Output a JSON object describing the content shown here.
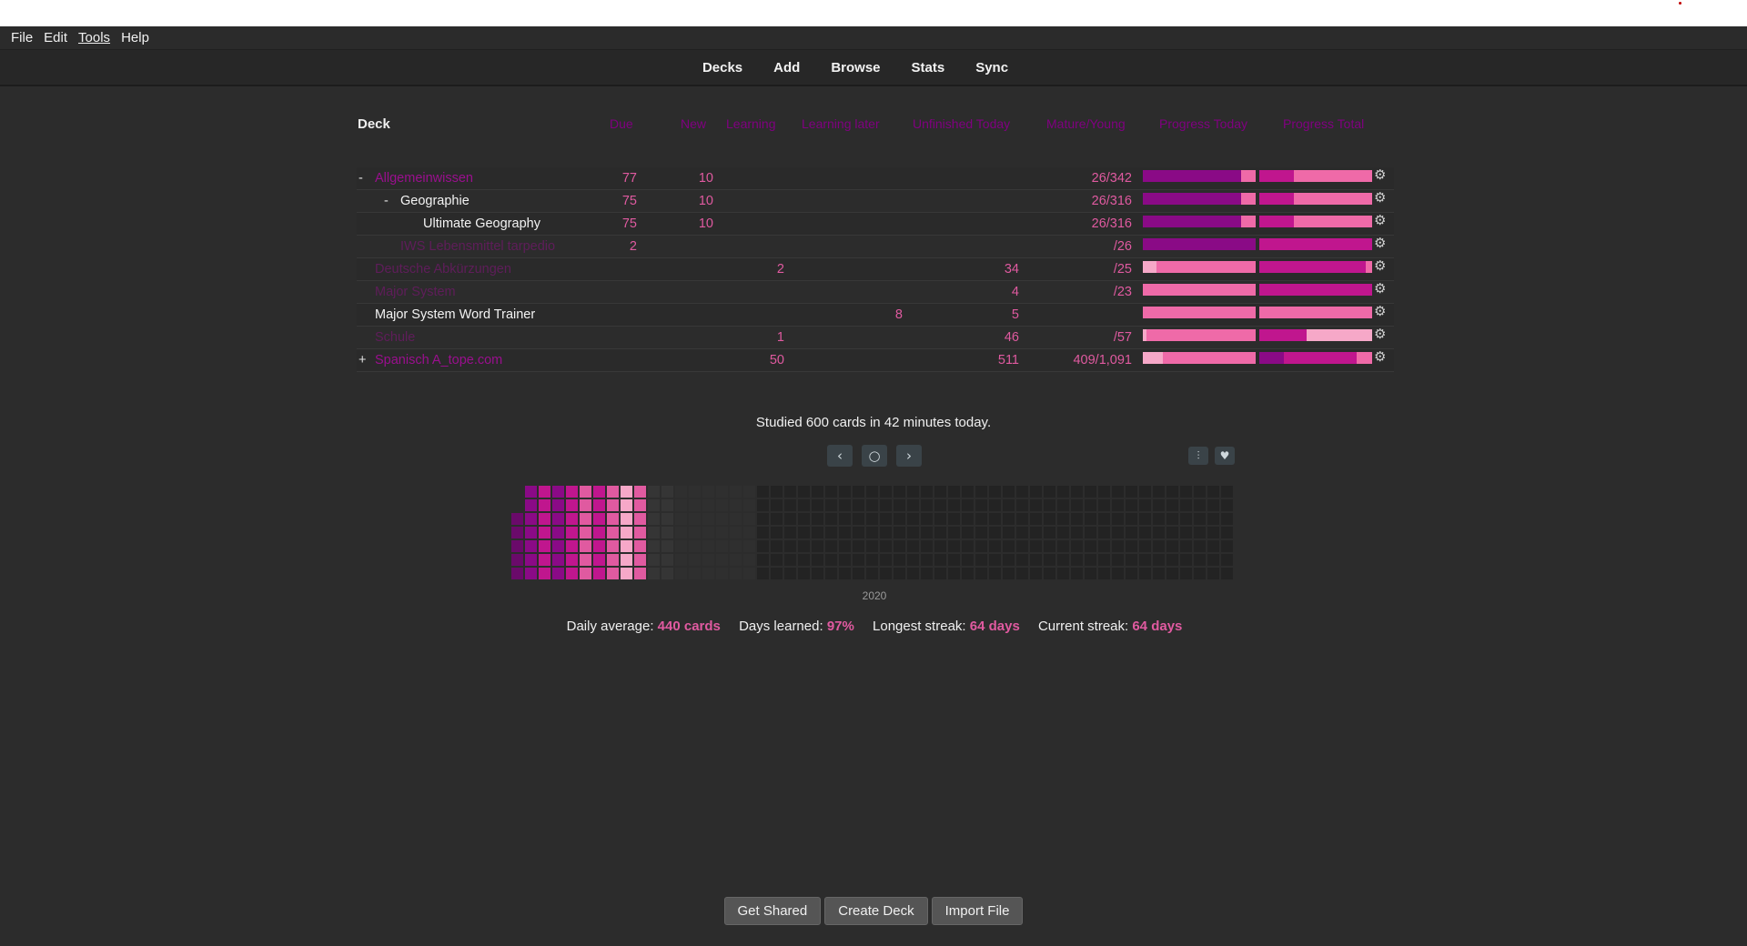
{
  "menu": {
    "file": "File",
    "edit": "Edit",
    "tools": "Tools",
    "help": "Help"
  },
  "toolbar": {
    "decks": "Decks",
    "add": "Add",
    "browse": "Browse",
    "stats": "Stats",
    "sync": "Sync"
  },
  "deck_table": {
    "header": {
      "deck": "Deck",
      "due": "Due",
      "new": "New",
      "learning": "Learning",
      "learning_later": "Learning later",
      "unfinished_today": "Unfinished Today",
      "mature_young": "Mature/Young",
      "progress_today": "Progress Today",
      "progress_total": "Progress Total"
    },
    "rows": [
      {
        "collapse": "-",
        "name": "Allgemeinwissen",
        "due": "77",
        "new": "10",
        "learning": "",
        "learning_later": "",
        "unfinished": "",
        "mature": "26/342"
      },
      {
        "collapse": "-",
        "name": "Geographie",
        "due": "75",
        "new": "10",
        "learning": "",
        "learning_later": "",
        "unfinished": "",
        "mature": "26/316"
      },
      {
        "collapse": "",
        "name": "Ultimate Geography",
        "due": "75",
        "new": "10",
        "learning": "",
        "learning_later": "",
        "unfinished": "",
        "mature": "26/316"
      },
      {
        "collapse": "",
        "name": "IWS Lebensmittel tarpedio",
        "due": "2",
        "new": "",
        "learning": "",
        "learning_later": "",
        "unfinished": "",
        "mature": "/26"
      },
      {
        "collapse": "",
        "name": "Deutsche Abkürzungen",
        "due": "",
        "new": "",
        "learning": "2",
        "learning_later": "",
        "unfinished": "34",
        "mature": "/25"
      },
      {
        "collapse": "",
        "name": "Major System",
        "due": "",
        "new": "",
        "learning": "",
        "learning_later": "",
        "unfinished": "4",
        "mature": "/23"
      },
      {
        "collapse": "",
        "name": "Major System Word Trainer",
        "due": "",
        "new": "",
        "learning": "",
        "learning_later": "8",
        "unfinished": "5",
        "mature": ""
      },
      {
        "collapse": "",
        "name": "Schule",
        "due": "",
        "new": "",
        "learning": "1",
        "learning_later": "",
        "unfinished": "46",
        "mature": "/57"
      },
      {
        "collapse": "+",
        "name": "Spanisch A_tope.com",
        "due": "",
        "new": "",
        "learning": "50",
        "learning_later": "",
        "unfinished": "511",
        "mature": "409/1,091"
      }
    ]
  },
  "progress": {
    "colors": {
      "dark": "#8a0a86",
      "mid": "#c0168e",
      "pink": "#ef6aa8",
      "light": "#f6a8c8",
      "accent": "#e05aa0"
    },
    "today": [
      [
        {
          "c": "dark",
          "f": 0.87
        },
        {
          "c": "pink",
          "f": 0.13
        }
      ],
      [
        {
          "c": "dark",
          "f": 0.87
        },
        {
          "c": "pink",
          "f": 0.13
        }
      ],
      [
        {
          "c": "dark",
          "f": 0.87
        },
        {
          "c": "pink",
          "f": 0.13
        }
      ],
      [
        {
          "c": "dark",
          "f": 1.0
        }
      ],
      [
        {
          "c": "light",
          "f": 0.12
        },
        {
          "c": "pink",
          "f": 0.88
        }
      ],
      [
        {
          "c": "pink",
          "f": 1.0
        }
      ],
      [
        {
          "c": "pink",
          "f": 1.0
        }
      ],
      [
        {
          "c": "light",
          "f": 0.03
        },
        {
          "c": "pink",
          "f": 0.97
        }
      ],
      [
        {
          "c": "light",
          "f": 0.18
        },
        {
          "c": "pink",
          "f": 0.82
        }
      ]
    ],
    "total": [
      [
        {
          "c": "mid",
          "f": 0.31
        },
        {
          "c": "pink",
          "f": 0.69
        }
      ],
      [
        {
          "c": "mid",
          "f": 0.31
        },
        {
          "c": "pink",
          "f": 0.69
        }
      ],
      [
        {
          "c": "mid",
          "f": 0.31
        },
        {
          "c": "pink",
          "f": 0.69
        }
      ],
      [
        {
          "c": "mid",
          "f": 1.0
        }
      ],
      [
        {
          "c": "mid",
          "f": 0.94
        },
        {
          "c": "pink",
          "f": 0.06
        }
      ],
      [
        {
          "c": "mid",
          "f": 1.0
        }
      ],
      [
        {
          "c": "pink",
          "f": 1.0
        }
      ],
      [
        {
          "c": "mid",
          "f": 0.42
        },
        {
          "c": "light",
          "f": 0.58
        }
      ],
      [
        {
          "c": "dark",
          "f": 0.22
        },
        {
          "c": "mid",
          "f": 0.64
        },
        {
          "c": "pink",
          "f": 0.14
        }
      ]
    ]
  },
  "stats": {
    "studied_text": "Studied 600 cards in 42 minutes today.",
    "year": "2020",
    "daily_average_label": "Daily average:",
    "daily_average_value": "440 cards",
    "days_learned_label": "Days learned:",
    "days_learned_value": "97%",
    "longest_streak_label": "Longest streak:",
    "longest_streak_value": "64 days",
    "current_streak_label": "Current streak:",
    "current_streak_value": "64 days"
  },
  "heatmap_nav": {
    "prev": "‹",
    "today": "○",
    "next": "›",
    "options_icon": "sliders-icon",
    "heart_icon": "heart-icon"
  },
  "buttons": {
    "get_shared": "Get Shared",
    "create_deck": "Create Deck",
    "import_file": "Import File"
  }
}
